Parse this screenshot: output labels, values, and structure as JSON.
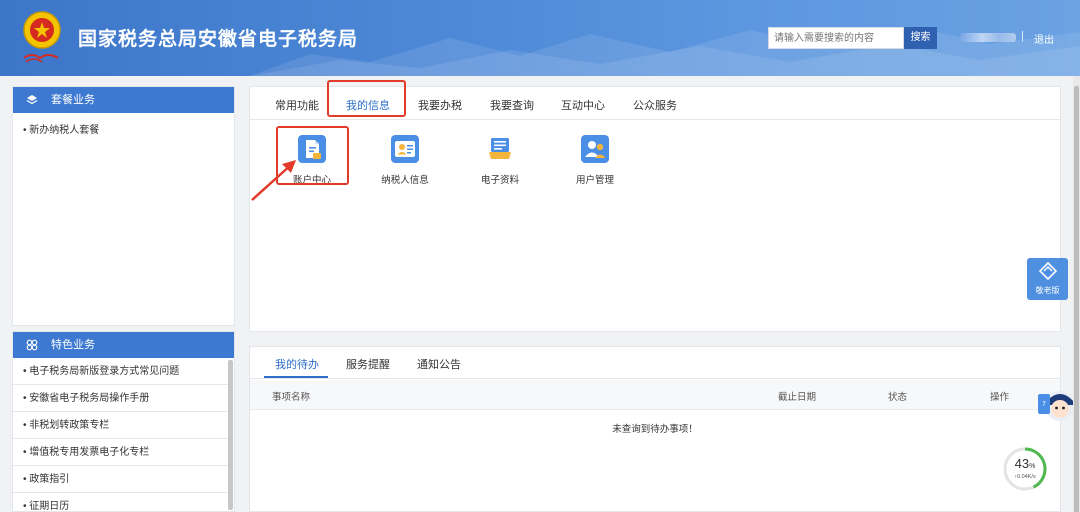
{
  "header": {
    "title": "国家税务总局安徽省电子税务局",
    "search_placeholder": "请输入需要搜索的内容",
    "search_button": "搜索",
    "separator": "|",
    "logout": "退出"
  },
  "left": {
    "package": {
      "title": "套餐业务",
      "items": [
        "新办纳税人套餐"
      ]
    },
    "special": {
      "title": "特色业务",
      "items": [
        "电子税务局新版登录方式常见问题",
        "安徽省电子税务局操作手册",
        "非税划转政策专栏",
        "增值税专用发票电子化专栏",
        "政策指引",
        "征期日历"
      ]
    }
  },
  "main": {
    "tabs": [
      "常用功能",
      "我的信息",
      "我要办税",
      "我要查询",
      "互动中心",
      "公众服务"
    ],
    "active_tab": "我的信息",
    "apps": [
      {
        "label": "账户中心",
        "icon": "account-center-icon"
      },
      {
        "label": "纳税人信息",
        "icon": "taxpayer-info-icon"
      },
      {
        "label": "电子资料",
        "icon": "electronic-docs-icon"
      },
      {
        "label": "用户管理",
        "icon": "user-management-icon"
      }
    ]
  },
  "todo": {
    "tabs": [
      "我的待办",
      "服务提醒",
      "通知公告"
    ],
    "active_tab": "我的待办",
    "columns": [
      "事项名称",
      "截止日期",
      "状态",
      "操作"
    ],
    "empty_text": "未查询到待办事项！"
  },
  "widgets": {
    "elder_mode": "敬老版",
    "speed_percent": "43",
    "speed_unit": "%",
    "speed_rate": "0.04K/s"
  },
  "colors": {
    "primary": "#3d79d0",
    "accent_text": "#2d6fc9",
    "highlight_red": "#e23b2c"
  }
}
